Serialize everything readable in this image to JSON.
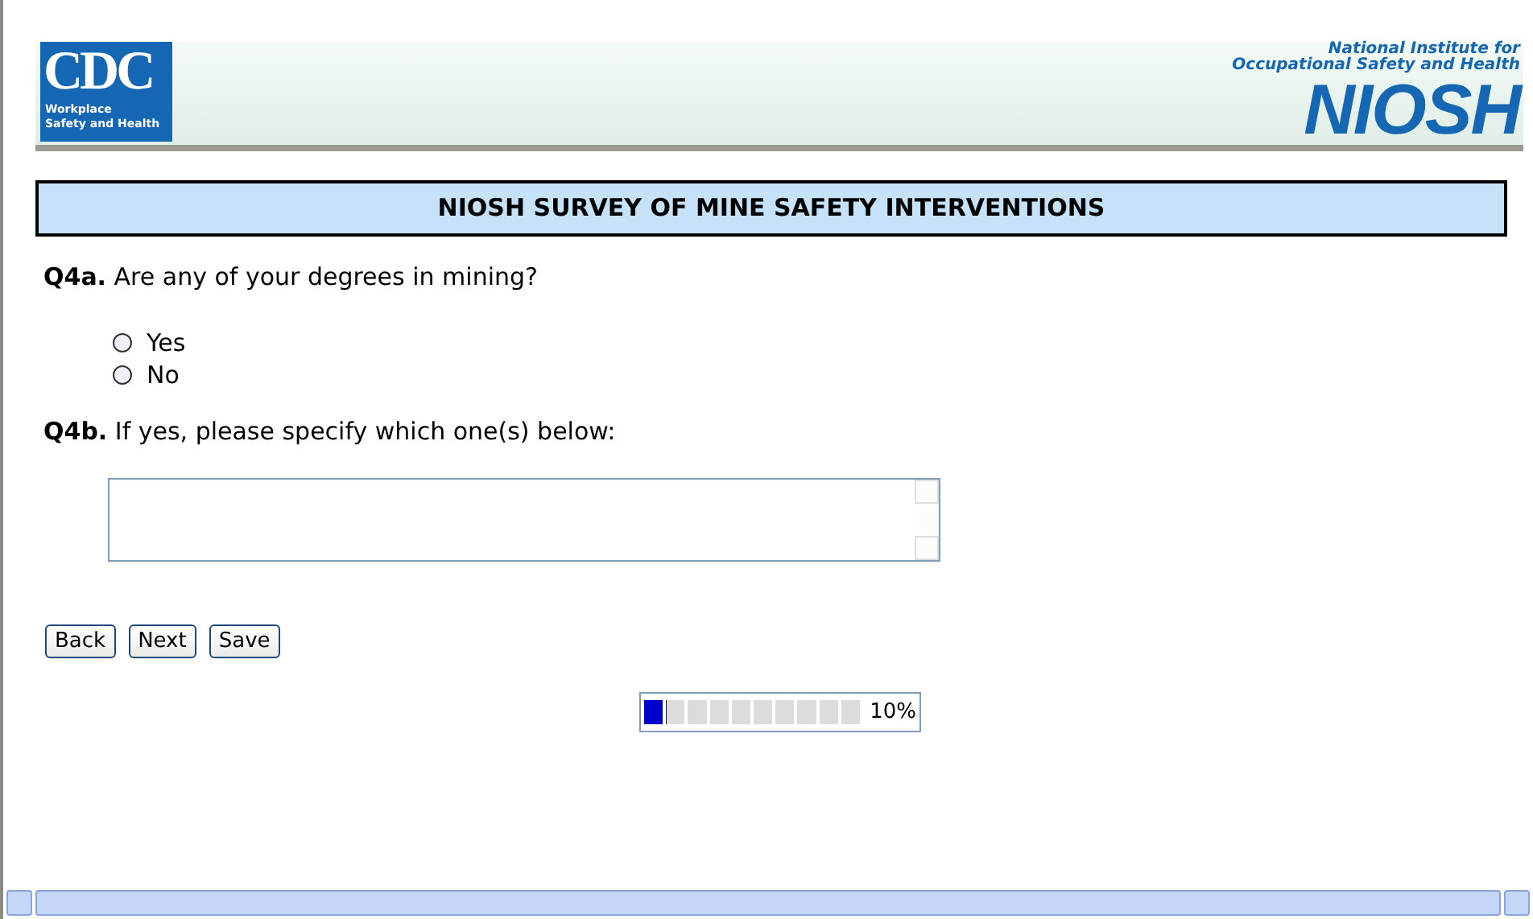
{
  "banner": {
    "cdc_logo": {
      "mark": "CDC",
      "line_1": "Workplace",
      "line_2": "Safety and Health"
    },
    "niosh_logo": {
      "line_1": "National Institute for",
      "line_2": "Occupational Safety and Health",
      "mark": "NIOSH"
    }
  },
  "survey_title": "NIOSH SURVEY OF MINE SAFETY INTERVENTIONS",
  "questions": [
    {
      "kind": "radio",
      "number": "Q4a.",
      "text": "Are any of your degrees in mining?",
      "options": [
        {
          "label": "Yes",
          "selected": false
        },
        {
          "label": "No",
          "selected": false
        }
      ]
    },
    {
      "kind": "textarea",
      "number": "Q4b.",
      "text": "If yes, please specify which one(s) below:"
    }
  ],
  "buttons": [
    "Back",
    "Next",
    "Save"
  ],
  "progress": {
    "level": 0.1,
    "reading": "10%"
  }
}
